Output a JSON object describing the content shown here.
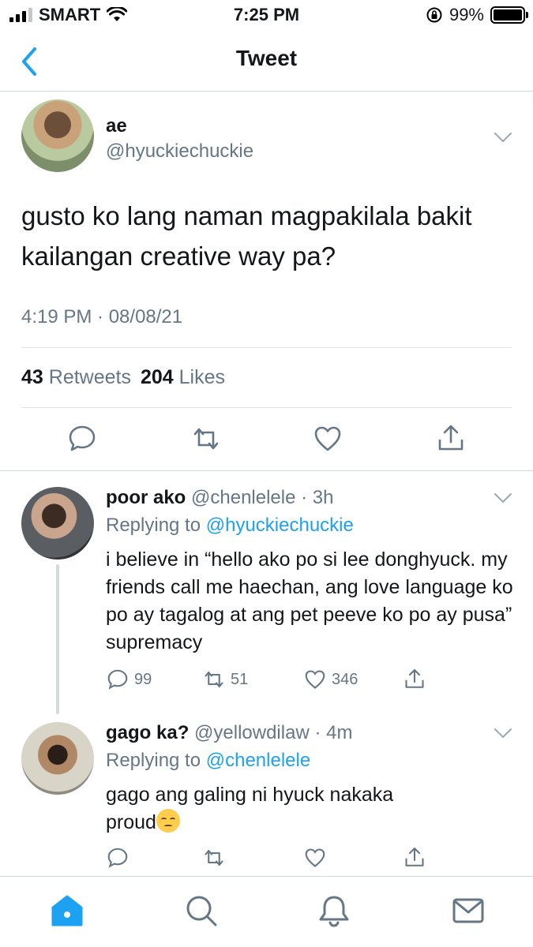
{
  "status_bar": {
    "carrier": "SMART",
    "time": "7:25 PM",
    "battery_percent": "99%",
    "battery_level": 0.99,
    "signal_bars_on": 3,
    "signal_bars_total": 4
  },
  "nav": {
    "title": "Tweet",
    "back_icon": "chevron-left-icon"
  },
  "main_tweet": {
    "display_name": "ae",
    "handle": "@hyuckiechuckie",
    "text": "gusto ko lang naman magpakilala bakit kailangan creative way pa?",
    "timestamp": "4:19 PM · 08/08/21",
    "retweets_count": "43",
    "retweets_label": "Retweets",
    "likes_count": "204",
    "likes_label": "Likes"
  },
  "replies": [
    {
      "display_name": "poor ako",
      "handle": "@chenlelele",
      "age": "· 3h",
      "replying_prefix": "Replying to",
      "replying_to": "@hyuckiechuckie",
      "text": "i believe in “hello ako po si lee donghyuck. my friends call me haechan, ang love language ko po ay tagalog at ang pet peeve ko po ay pusa” supremacy",
      "reply_count": "99",
      "retweet_count": "51",
      "like_count": "346"
    },
    {
      "display_name": "gago ka?",
      "handle": "@yellowdilaw",
      "age": "· 4m",
      "replying_prefix": "Replying to",
      "replying_to": "@chenlelele",
      "text": "gago ang galing ni hyuck nakaka proud",
      "emoji": "pensive-face-emoji"
    }
  ],
  "tab_bar": {
    "items": [
      "home-icon",
      "search-icon",
      "notifications-icon",
      "messages-icon"
    ],
    "active": "home-icon"
  },
  "colors": {
    "accent": "#1da1f2",
    "secondary_text": "#657786",
    "divider": "#cfd9de"
  }
}
